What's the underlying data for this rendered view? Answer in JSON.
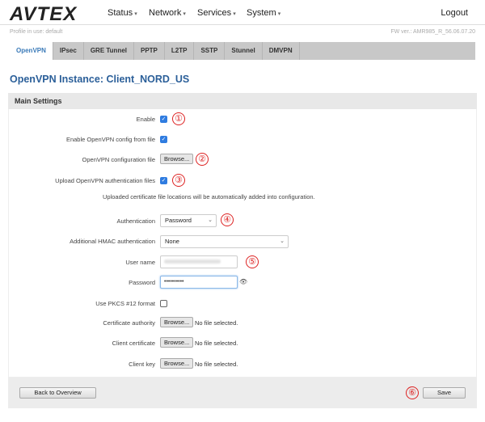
{
  "header": {
    "logo": "AVTEX",
    "nav": [
      "Status",
      "Network",
      "Services",
      "System"
    ],
    "logout": "Logout",
    "profile": "Profile in use: default",
    "fw": "FW ver.: AMR985_R_56.06.07.20"
  },
  "tabs": [
    "OpenVPN",
    "IPsec",
    "GRE Tunnel",
    "PPTP",
    "L2TP",
    "SSTP",
    "Stunnel",
    "DMVPN"
  ],
  "title": "OpenVPN Instance: Client_NORD_US",
  "section": "Main Settings",
  "form": {
    "enable": "Enable",
    "config_from_file": "Enable OpenVPN config from file",
    "config_file": "OpenVPN configuration file",
    "upload_auth": "Upload OpenVPN authentication files",
    "note": "Uploaded certificate file locations will be automatically added into configuration.",
    "authentication": "Authentication",
    "authentication_value": "Password",
    "hmac": "Additional HMAC authentication",
    "hmac_value": "None",
    "username": "User name",
    "password": "Password",
    "password_value": "••••••••••",
    "pkcs": "Use PKCS #12 format",
    "ca": "Certificate authority",
    "client_cert": "Client certificate",
    "client_key": "Client key",
    "browse": "Browse...",
    "no_file": "No file selected.",
    "check": "✓"
  },
  "annotations": [
    "①",
    "②",
    "③",
    "④",
    "⑤",
    "⑥"
  ],
  "footer": {
    "back": "Back to Overview",
    "save": "Save"
  },
  "colors": {
    "accent": "#2b5f99",
    "checkbox": "#2f7ce0",
    "annotation": "#dd2222"
  }
}
